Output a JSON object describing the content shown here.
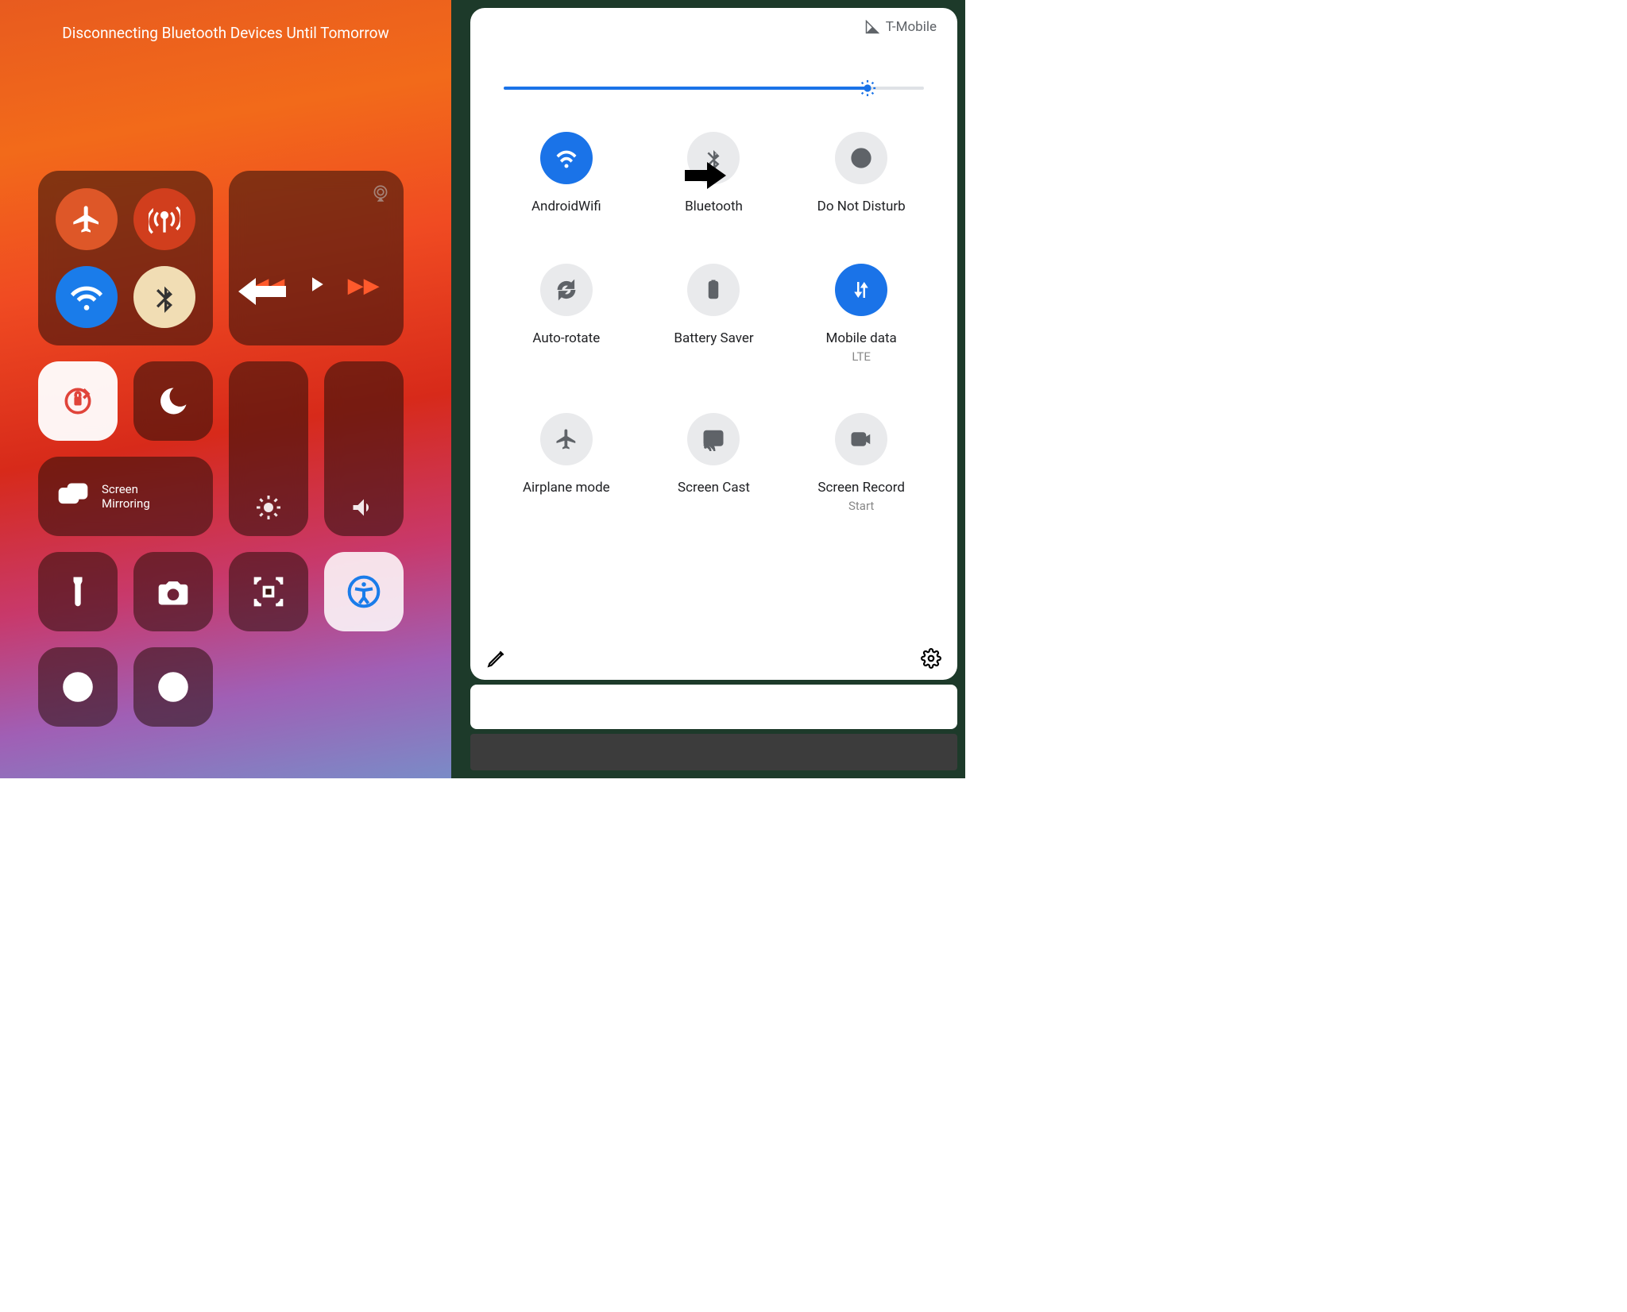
{
  "ios": {
    "banner": "Disconnecting Bluetooth Devices Until Tomorrow",
    "screen_mirroring_line1": "Screen",
    "screen_mirroring_line2": "Mirroring",
    "icons": {
      "airplane": "airplane-icon",
      "cellular": "antenna-icon",
      "wifi": "wifi-icon",
      "bluetooth": "bluetooth-icon",
      "airplay": "airplay-icon",
      "play": "play-icon",
      "rewind": "rewind-icon",
      "forward": "forward-icon",
      "rotation_lock": "rotation-lock-icon",
      "dnd": "moon-icon",
      "brightness": "sun-icon",
      "volume": "speaker-icon",
      "mirror": "screen-mirroring-icon",
      "flashlight": "flashlight-icon",
      "camera": "camera-icon",
      "qr": "qr-scan-icon",
      "accessibility": "accessibility-icon",
      "record": "record-icon",
      "darkmode": "dark-mode-icon"
    },
    "states": {
      "airplane": false,
      "cellular": true,
      "wifi": true,
      "bluetooth": true,
      "rotation_lock": true,
      "dnd": false,
      "accessibility": true
    }
  },
  "android": {
    "carrier": "T-Mobile",
    "brightness_percent": 82,
    "tiles": [
      {
        "key": "wifi",
        "label": "AndroidWifi",
        "on": true,
        "icon": "wifi-icon"
      },
      {
        "key": "bluetooth",
        "label": "Bluetooth",
        "on": false,
        "icon": "bluetooth-icon"
      },
      {
        "key": "dnd",
        "label": "Do Not Disturb",
        "on": false,
        "icon": "dnd-circle-icon"
      },
      {
        "key": "autorotate",
        "label": "Auto-rotate",
        "on": false,
        "icon": "autorotate-icon"
      },
      {
        "key": "battery",
        "label": "Battery Saver",
        "on": false,
        "icon": "battery-saver-icon"
      },
      {
        "key": "mobiledata",
        "label": "Mobile data",
        "sub": "LTE",
        "on": true,
        "icon": "mobile-data-icon"
      },
      {
        "key": "airplane",
        "label": "Airplane mode",
        "on": false,
        "icon": "airplane-icon"
      },
      {
        "key": "cast",
        "label": "Screen Cast",
        "on": false,
        "icon": "cast-icon"
      },
      {
        "key": "record",
        "label": "Screen Record",
        "sub": "Start",
        "on": false,
        "icon": "screen-record-icon"
      }
    ],
    "footer": {
      "edit": "edit-icon",
      "settings": "settings-icon"
    }
  }
}
